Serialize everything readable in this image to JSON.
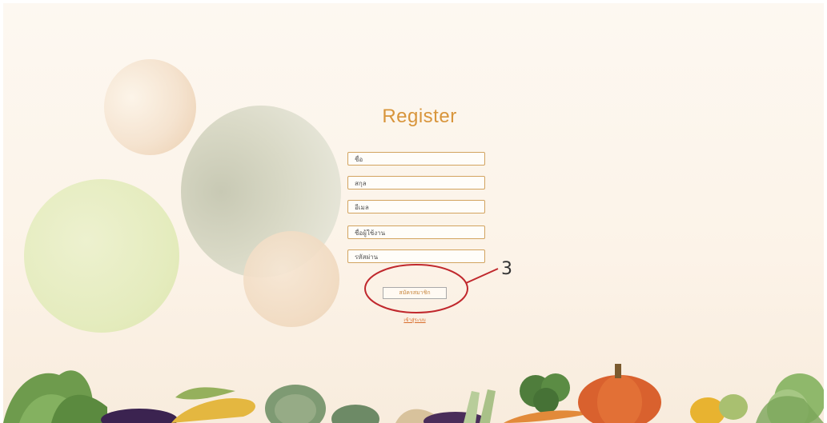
{
  "form": {
    "title": "Register",
    "fields": [
      {
        "placeholder": "ชื่อ"
      },
      {
        "placeholder": "สกุล"
      },
      {
        "placeholder": "อีเมล"
      },
      {
        "placeholder": "ชื่อผู้ใช้งาน"
      },
      {
        "placeholder": "รหัสผ่าน"
      }
    ],
    "submit_label": "สมัครสมาชิก",
    "login_link": "เข้าสู่ระบบ"
  },
  "annotation": {
    "number": "3",
    "color": "#c0282d"
  },
  "colors": {
    "accent": "#d8953b",
    "field_border": "#d2a35f",
    "link": "#d86d2c"
  }
}
